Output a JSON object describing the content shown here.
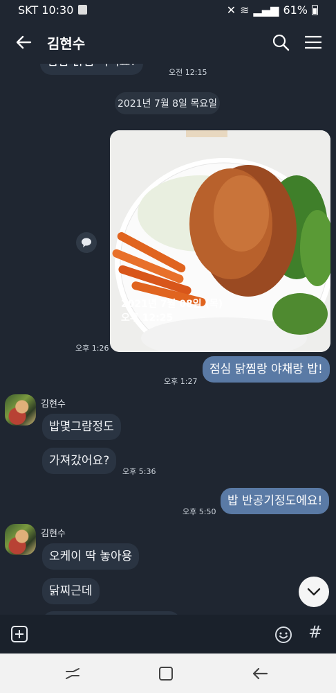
{
  "status": {
    "carrier_time": "SKT 10:30",
    "battery": "61%"
  },
  "header": {
    "title": "김현수"
  },
  "chat": {
    "top_cut_message": "점심 닭찜 먹어요?",
    "top_time": "오전 12:15",
    "date_divider": "2021년 7월 8일 목요일",
    "photo": {
      "overlay_date": "2021년 7월 08일 (목)",
      "overlay_time": "오후 12:25",
      "time": "오후 1:26"
    },
    "messages": [
      {
        "text": "점심 닭찜랑 야채랑 밥!",
        "time": "오후 1:27"
      },
      {
        "sender": "김현수",
        "text": "밥몇그람정도"
      },
      {
        "text": "가져갔어요?",
        "time": "오후 5:36"
      },
      {
        "text": "밥 반공기정도에요!",
        "time": "오후 5:50"
      },
      {
        "sender": "김현수",
        "text": "오케이 딱 놓아용"
      },
      {
        "text": "닭찌근데"
      }
    ]
  },
  "input": {
    "hash_label": "#"
  },
  "colors": {
    "background": "#1f2631",
    "incoming": "#2a3442",
    "outgoing": "#5a7aa5"
  }
}
